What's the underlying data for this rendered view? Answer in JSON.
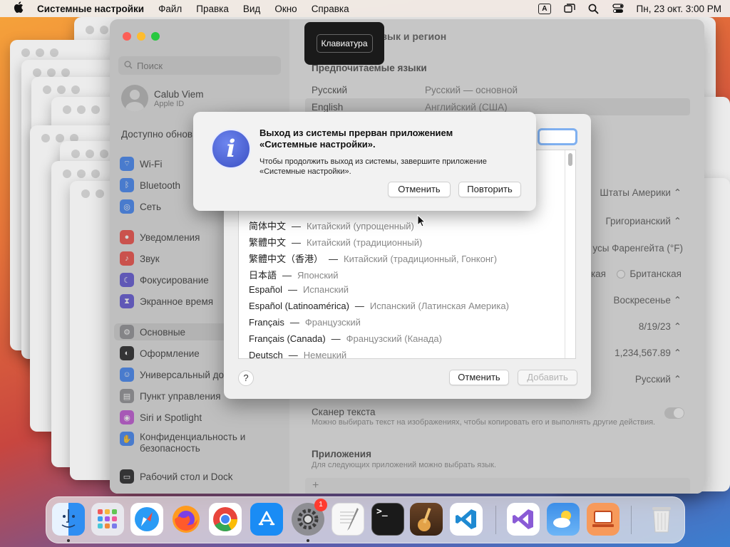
{
  "menubar": {
    "app_name": "Системные настройки",
    "items": [
      "Файл",
      "Правка",
      "Вид",
      "Окно",
      "Справка"
    ],
    "input_source": "A",
    "datetime": "Пн, 23 окт.  3:00 PM"
  },
  "tooltip": {
    "text": "Клавиатура"
  },
  "settings": {
    "search_placeholder": "Поиск",
    "user": {
      "name": "Calub Viem",
      "subtitle": "Apple ID"
    },
    "update_label": "Доступно обнов",
    "sidebar_items": [
      {
        "label": "Wi-Fi",
        "icon": "wifi-icon",
        "color": "#3a82f7"
      },
      {
        "label": "Bluetooth",
        "icon": "bluetooth-icon",
        "color": "#3a82f7"
      },
      {
        "label": "Сеть",
        "icon": "globe-icon",
        "color": "#3a82f7"
      },
      {
        "label": "Уведомления",
        "icon": "bell-icon",
        "color": "#f2473f"
      },
      {
        "label": "Звук",
        "icon": "speaker-icon",
        "color": "#f2473f"
      },
      {
        "label": "Фокусирование",
        "icon": "moon-icon",
        "color": "#5b4fd6"
      },
      {
        "label": "Экранное время",
        "icon": "hourglass-icon",
        "color": "#5b4fd6"
      },
      {
        "label": "Основные",
        "icon": "gear-icon",
        "color": "#8e8e93"
      },
      {
        "label": "Оформление",
        "icon": "appearance-icon",
        "color": "#1c1c1e"
      },
      {
        "label": "Универсальный до",
        "icon": "accessibility-icon",
        "color": "#3a82f7"
      },
      {
        "label": "Пункт управления",
        "icon": "control-center-icon",
        "color": "#8e8e93"
      },
      {
        "label": "Siri и Spotlight",
        "icon": "siri-icon",
        "color": "#c14fd6"
      },
      {
        "label": "Конфиденциальность и безопасность",
        "icon": "hand-icon",
        "color": "#3a82f7"
      },
      {
        "label": "Рабочий стол и Dock",
        "icon": "dock-icon",
        "color": "#1c1c1e"
      }
    ],
    "content": {
      "title": "Язык и регион",
      "preferred_languages_header": "Предпочитаемые языки",
      "languages": [
        {
          "name": "Русский",
          "detail": "Русский — основной"
        },
        {
          "name": "English",
          "detail": "Английский (США)"
        }
      ],
      "region_value": "Штаты Америки",
      "calendar_value": "Григорианский",
      "temperature_value": "усы Фаренгейта (°F)",
      "measurement_left": "кая",
      "measurement_right": "Британская",
      "first_day_value": "Воскресенье",
      "date_format_value": "8/19/23",
      "number_format_value": "1,234,567.89",
      "list_sort_value": "Русский",
      "live_text_label": "Сканер текста",
      "live_text_desc": "Можно выбирать текст на изображениях, чтобы копировать его и выполнять другие действия.",
      "apps_header": "Приложения",
      "apps_desc": "Для следующих приложений можно выбрать язык."
    }
  },
  "language_sheet": {
    "items": [
      {
        "native": "简体中文",
        "russian": "Китайский (упрощенный)"
      },
      {
        "native": "繁體中文",
        "russian": "Китайский (традиционный)"
      },
      {
        "native": "繁體中文（香港）",
        "russian": "Китайский (традиционный, Гонконг)"
      },
      {
        "native": "日本語",
        "russian": "Японский"
      },
      {
        "native": "Español",
        "russian": "Испанский"
      },
      {
        "native": "Español (Latinoamérica)",
        "russian": "Испанский (Латинская Америка)"
      },
      {
        "native": "Français",
        "russian": "Французский"
      },
      {
        "native": "Français (Canada)",
        "russian": "Французский (Канада)"
      },
      {
        "native": "Deutsch",
        "russian": "Немецкий"
      }
    ],
    "help_label": "?",
    "cancel_label": "Отменить",
    "add_label": "Добавить"
  },
  "alert": {
    "icon_glyph": "i",
    "title": "Выход из системы прерван приложением «Системные настройки».",
    "message": "Чтобы продолжить выход из системы, завершите приложение «Системные настройки».",
    "cancel_label": "Отменить",
    "retry_label": "Повторить"
  },
  "dock": {
    "apps": [
      {
        "name": "Finder",
        "icon": "finder-icon",
        "color": "#2f8ef2"
      },
      {
        "name": "Launchpad",
        "icon": "launchpad-icon",
        "color": "#e8e8ee"
      },
      {
        "name": "Safari",
        "icon": "safari-icon",
        "color": "#1e8ff0"
      },
      {
        "name": "Firefox",
        "icon": "firefox-icon",
        "color": "#ff7b1c"
      },
      {
        "name": "Chrome",
        "icon": "chrome-icon",
        "color": "#ffffff"
      },
      {
        "name": "App Store",
        "icon": "app-store-icon",
        "color": "#1a8cf5"
      },
      {
        "name": "System Settings",
        "icon": "system-settings-icon",
        "color": "#8e8e93",
        "badge": "1"
      },
      {
        "name": "TextEdit",
        "icon": "textedit-icon",
        "color": "#f4f4f4"
      },
      {
        "name": "Terminal",
        "icon": "terminal-icon",
        "color": "#1a1a1a",
        "glyph": ">_"
      },
      {
        "name": "GarageBand",
        "icon": "garageband-icon",
        "color": "#5a3b23"
      },
      {
        "name": "Visual Studio Code",
        "icon": "vscode-icon",
        "color": "#ffffff"
      },
      {
        "name": "Visual Studio",
        "icon": "visual-studio-icon",
        "color": "#ffffff"
      },
      {
        "name": "Weather",
        "icon": "weather-icon",
        "color": "#3c8ee8"
      },
      {
        "name": "Remote Desktop",
        "icon": "remote-desktop-icon",
        "color": "#f79a5b"
      },
      {
        "name": "Trash",
        "icon": "trash-icon",
        "color": "#e4e4e4"
      }
    ]
  }
}
